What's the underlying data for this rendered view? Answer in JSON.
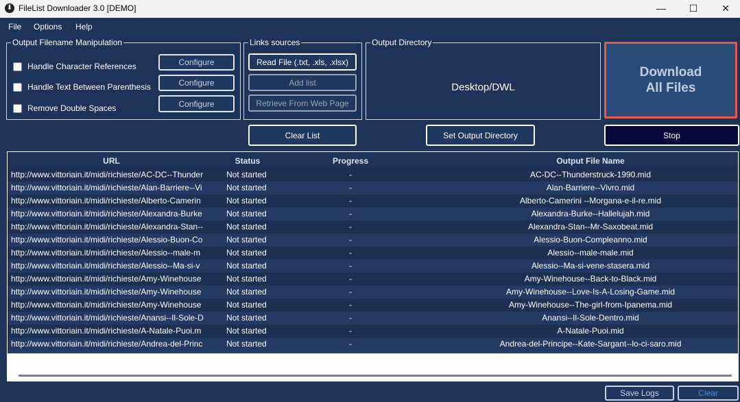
{
  "window": {
    "title": "FileList Downloader 3.0 [DEMO]",
    "controls": {
      "minimize": "—",
      "maximize": "☐",
      "close": "✕"
    }
  },
  "menu": [
    "File",
    "Options",
    "Help"
  ],
  "filename_group": {
    "legend": "Output Filename Manipulation",
    "options": [
      {
        "label": "Handle Character References",
        "checked": false,
        "button": "Configure"
      },
      {
        "label": "Handle Text Between Parenthesis",
        "checked": false,
        "button": "Configure"
      },
      {
        "label": "Remove Double Spaces",
        "checked": false,
        "button": "Configure"
      }
    ]
  },
  "links_group": {
    "legend": "Links sources",
    "read_file": "Read File (.txt, .xls, .xlsx)",
    "add_list": "Add list",
    "retrieve_web": "Retrieve From Web Page"
  },
  "output_group": {
    "legend": "Output Directory",
    "path": "Desktop/DWL"
  },
  "actions": {
    "download_line1": "Download",
    "download_line2": "All Files",
    "clear_list": "Clear List",
    "set_output_dir": "Set Output Directory",
    "stop": "Stop",
    "save_logs": "Save Logs",
    "clear": "Clear"
  },
  "table": {
    "columns": [
      "URL",
      "Status",
      "Progress",
      "Output File Name"
    ],
    "rows": [
      [
        "http://www.vittoriain.it/midi/richieste/AC-DC--Thunder",
        "Not started",
        "-",
        "AC-DC--Thunderstruck-1990.mid"
      ],
      [
        "http://www.vittoriain.it/midi/richieste/Alan-Barriere--Vi",
        "Not started",
        "-",
        "Alan-Barriere--Vivro.mid"
      ],
      [
        "http://www.vittoriain.it/midi/richieste/Alberto-Camerin",
        "Not started",
        "-",
        "Alberto-Camerini --Morgana-e-il-re.mid"
      ],
      [
        "http://www.vittoriain.it/midi/richieste/Alexandra-Burke",
        "Not started",
        "-",
        "Alexandra-Burke--Hallelujah.mid"
      ],
      [
        "http://www.vittoriain.it/midi/richieste/Alexandra-Stan--",
        "Not started",
        "-",
        "Alexandra-Stan--Mr-Saxobeat.mid"
      ],
      [
        "http://www.vittoriain.it/midi/richieste/Alessio-Buon-Co",
        "Not started",
        "-",
        "Alessio-Buon-Compleanno.mid"
      ],
      [
        "http://www.vittoriain.it/midi/richieste/Alessio--male-m",
        "Not started",
        "-",
        "Alessio--male-male.mid"
      ],
      [
        "http://www.vittoriain.it/midi/richieste/Alessio--Ma-si-v",
        "Not started",
        "-",
        "Alessio--Ma-si-vene-stasera.mid"
      ],
      [
        "http://www.vittoriain.it/midi/richieste/Amy-Winehouse",
        "Not started",
        "-",
        "Amy-Winehouse--Back-to-Black.mid"
      ],
      [
        "http://www.vittoriain.it/midi/richieste/Amy-Winehouse",
        "Not started",
        "-",
        "Amy-Winehouse--Love-Is-A-Losing-Game.mid"
      ],
      [
        "http://www.vittoriain.it/midi/richieste/Amy-Winehouse",
        "Not started",
        "-",
        "Amy-Winehouse--The-girl-from-Ipanema.mid"
      ],
      [
        "http://www.vittoriain.it/midi/richieste/Anansi--Il-Sole-D",
        "Not started",
        "-",
        "Anansi--Il-Sole-Dentro.mid"
      ],
      [
        "http://www.vittoriain.it/midi/richieste/A-Natale-Puoi.m",
        "Not started",
        "-",
        "A-Natale-Puoi.mid"
      ],
      [
        "http://www.vittoriain.it/midi/richieste/Andrea-del-Princ",
        "Not started",
        "-",
        "Andrea-del-Principe--Kate-Sargant--lo-ci-saro.mid"
      ]
    ]
  }
}
